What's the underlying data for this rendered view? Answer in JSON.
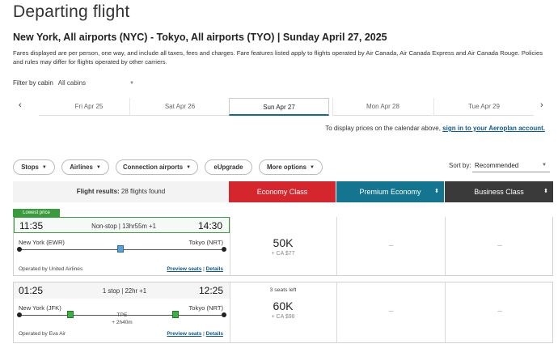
{
  "page": {
    "title": "Departing flight",
    "route": "New York, All airports (NYC) - Tokyo, All airports (TYO)  |  Sunday April 27, 2025",
    "disclaimer": "Fares displayed are per person, one way, and include all taxes, fees and charges. Fare features listed apply to flights operated by Air Canada, Air Canada Express and Air Canada Rouge. Policies and rules may differ for flights operated by other carriers."
  },
  "filter": {
    "label": "Filter by cabin",
    "value": "All cabins"
  },
  "dates": [
    {
      "label": "Fri Apr 25"
    },
    {
      "label": "Sat Apr 26"
    },
    {
      "label": "Sun Apr 27"
    },
    {
      "label": "Mon Apr 28"
    },
    {
      "label": "Tue Apr 29"
    }
  ],
  "aeroplan": {
    "text": "To display prices on the calendar above, ",
    "link": "sign in to your Aeroplan account."
  },
  "pills": [
    {
      "label": "Stops"
    },
    {
      "label": "Airlines"
    },
    {
      "label": "Connection airports"
    },
    {
      "label": "eUpgrade"
    },
    {
      "label": "More options"
    }
  ],
  "sort": {
    "label": "Sort by:",
    "value": "Recommended"
  },
  "results": {
    "label": "Flight results:",
    "count": "28 flights found"
  },
  "cabins": {
    "economy": "Economy Class",
    "premium": "Premium Economy",
    "business": "Business Class"
  },
  "badge": "Lowest price",
  "flights": [
    {
      "dep": "11:35",
      "arr": "14:30",
      "stops": "Non-stop | 13hr55m +1",
      "from": "New York (EWR)",
      "to": "Tokyo (NRT)",
      "operated": "Operated by United Airlines",
      "preview": "Preview seats",
      "sep": "|",
      "details": "Details",
      "economy_points": "50K",
      "economy_cash": "+ CA $77",
      "premium": "–",
      "business": "–"
    },
    {
      "dep": "01:25",
      "arr": "12:25",
      "stops": "1 stop | 22hr +1",
      "from": "New York (JFK)",
      "to": "Tokyo (NRT)",
      "via": "TPE",
      "layover": "+ 2h40m",
      "operated": "Operated by Eva Air",
      "preview": "Preview seats",
      "sep": "|",
      "details": "Details",
      "seats_left": "3 seats left",
      "economy_points": "60K",
      "economy_cash": "+ CA $98",
      "premium": "–",
      "business": "–"
    }
  ],
  "icons": {
    "prev": "chevron-left-icon",
    "next": "chevron-right-icon",
    "caret": "caret-down-icon",
    "tail": "airline-tail-icon"
  },
  "colors": {
    "economy": "#d6262d",
    "premium": "#13758f",
    "business": "#3a3a3a",
    "lowest": "#3a9b3e",
    "link": "#0c5a8f"
  }
}
